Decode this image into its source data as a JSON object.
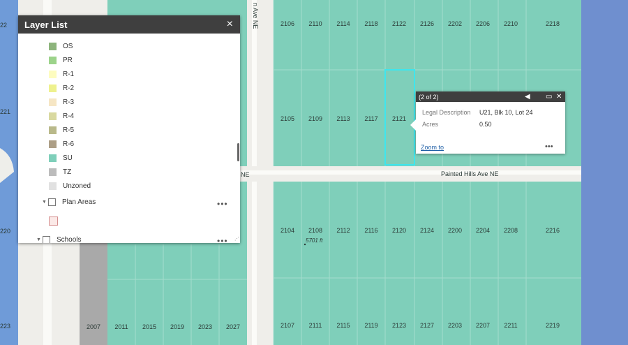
{
  "layer_list": {
    "title": "Layer List",
    "close_glyph": "×",
    "legend": [
      {
        "label": "OS",
        "color": "#8db47c"
      },
      {
        "label": "PR",
        "color": "#9cd38a"
      },
      {
        "label": "R-1",
        "color": "#fdfcbf"
      },
      {
        "label": "R-2",
        "color": "#eef18e"
      },
      {
        "label": "R-3",
        "color": "#f6e6c4"
      },
      {
        "label": "R-4",
        "color": "#d9d9a0"
      },
      {
        "label": "R-5",
        "color": "#b9b98a"
      },
      {
        "label": "R-6",
        "color": "#ad9f86"
      },
      {
        "label": "SU",
        "color": "#7fcfba"
      },
      {
        "label": "TZ",
        "color": "#bcbcbc"
      },
      {
        "label": "Unzoned",
        "color": "#e1e1e1"
      }
    ],
    "groups": [
      {
        "label": "Plan Areas",
        "more": "•••"
      },
      {
        "label": "Schools",
        "more": "•••"
      }
    ]
  },
  "popup": {
    "header": "(2 of 2)",
    "fields": [
      {
        "key": "Legal Description",
        "value": "U21, Blk 10, Lot 24"
      },
      {
        "key": "Acres",
        "value": "0.50"
      }
    ],
    "zoom_label": "Zoom to",
    "more": "•••"
  },
  "map": {
    "streets": [
      {
        "name": "Painted Hills Ave NE"
      },
      {
        "name": "n Ave NE"
      },
      {
        "name": "NE"
      }
    ],
    "elevation_label": "5701 ft",
    "parcels_row1": [
      "2106",
      "2110",
      "2114",
      "2118",
      "2122",
      "2126",
      "2202",
      "2206",
      "2210",
      "2218"
    ],
    "parcels_row2": [
      "2105",
      "2109",
      "2113",
      "2117",
      "2121"
    ],
    "parcels_row3": [
      "2104",
      "2108",
      "2112",
      "2116",
      "2120",
      "2124",
      "2200",
      "2204",
      "2208",
      "2216"
    ],
    "parcels_row4": [
      "2107",
      "2111",
      "2115",
      "2119",
      "2123",
      "2127",
      "2203",
      "2207",
      "2211",
      "2219"
    ],
    "parcels_row4_left": [
      "2007",
      "2011",
      "2015",
      "2019",
      "2023",
      "2027"
    ],
    "edge_labels": [
      "22",
      "221",
      "220",
      "223"
    ],
    "colors": {
      "su_parcel": "#7fcfba",
      "water": "#6f8fcf",
      "road": "#eeeeea",
      "selection": "#3ee6ee"
    }
  }
}
